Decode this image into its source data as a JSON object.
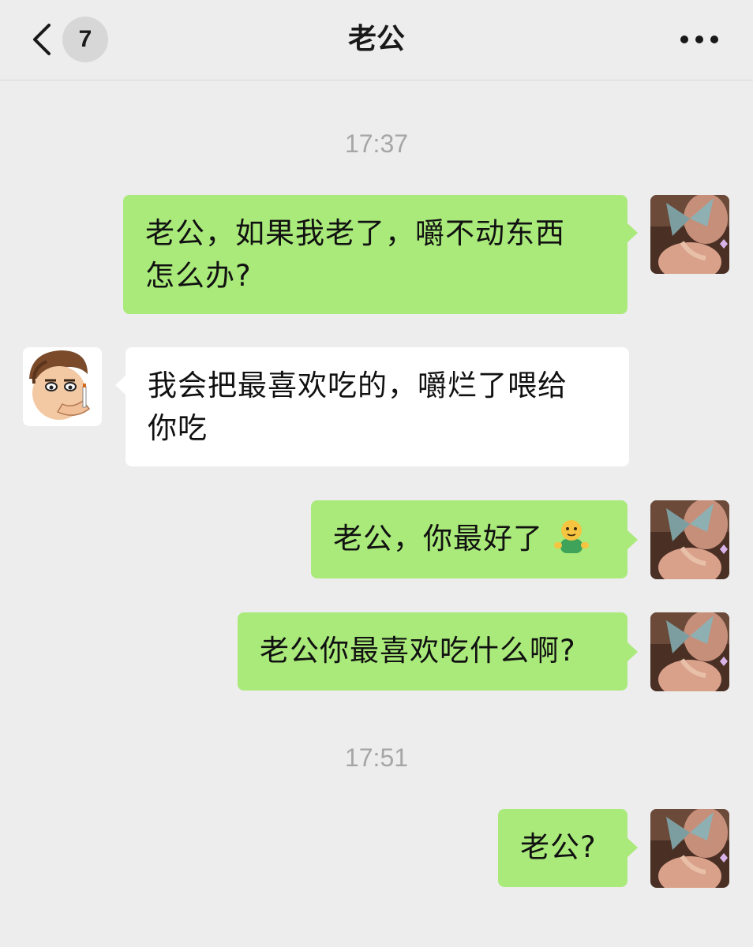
{
  "header": {
    "unread_count": "7",
    "title": "老公"
  },
  "messages": [
    {
      "type": "timestamp",
      "text": "17:37"
    },
    {
      "type": "sent",
      "line1": "老公，如果我老了，嚼不动东西",
      "line2": "怎么办?"
    },
    {
      "type": "received",
      "line1": "我会把最喜欢吃的，嚼烂了喂给",
      "line2": "你吃"
    },
    {
      "type": "sent",
      "text": "老公，你最好了",
      "emoji": "smiling-figure-emoji"
    },
    {
      "type": "sent",
      "text": "老公你最喜欢吃什么啊?"
    },
    {
      "type": "timestamp",
      "text": "17:51"
    },
    {
      "type": "sent",
      "text": "老公?"
    }
  ],
  "colors": {
    "background": "#ededed",
    "sent_bubble": "#a9ea7a",
    "received_bubble": "#ffffff",
    "timestamp": "#a6a6a6"
  },
  "icons": {
    "back": "chevron-left-icon",
    "more": "more-dots-icon",
    "self_avatar": "butterfly-girl-avatar",
    "partner_avatar": "cartoon-man-avatar"
  }
}
